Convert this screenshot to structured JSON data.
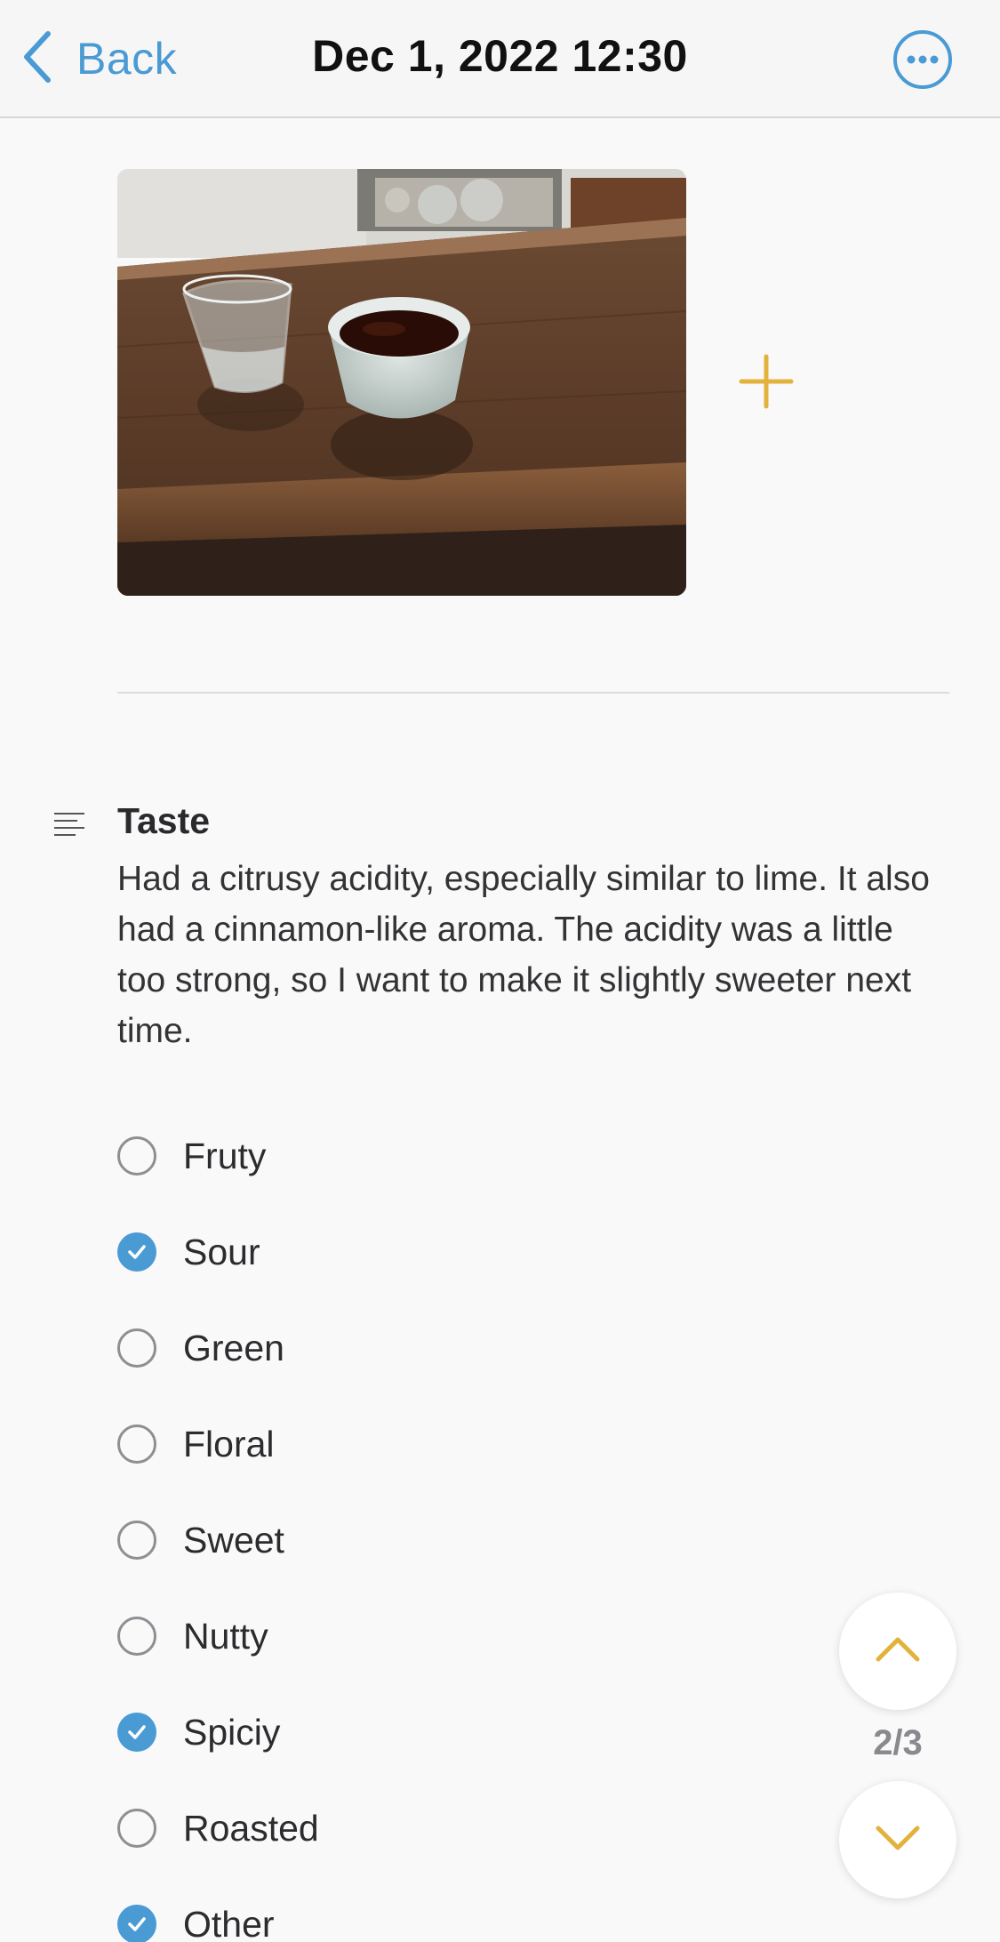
{
  "nav": {
    "back_label": "Back",
    "title": "Dec 1, 2022 12:30",
    "more_icon": "ellipsis-circle-icon"
  },
  "colors": {
    "accent_blue": "#4a9ad4",
    "accent_gold": "#e3b23c",
    "background": "#f9f9fa"
  },
  "photo": {
    "icon_add": "plus-icon"
  },
  "taste": {
    "icon": "notes-lines-icon",
    "title": "Taste",
    "body": "Had a citrusy acidity, especially similar to lime. It also had a cinnamon-like aroma. The acidity was a little too strong, so I want to make it slightly sweeter next time."
  },
  "options": [
    {
      "label": "Fruty",
      "checked": false
    },
    {
      "label": "Sour",
      "checked": true
    },
    {
      "label": "Green",
      "checked": false
    },
    {
      "label": "Floral",
      "checked": false
    },
    {
      "label": "Sweet",
      "checked": false
    },
    {
      "label": "Nutty",
      "checked": false
    },
    {
      "label": "Spiciy",
      "checked": true
    },
    {
      "label": "Roasted",
      "checked": false
    },
    {
      "label": "Other",
      "checked": true
    }
  ],
  "pager": {
    "label": "2/3",
    "up_icon": "chevron-up-icon",
    "down_icon": "chevron-down-icon"
  }
}
